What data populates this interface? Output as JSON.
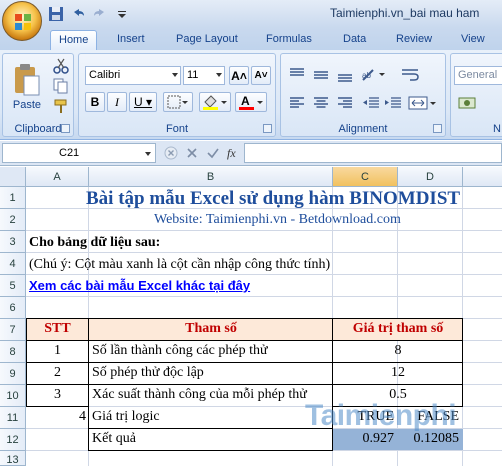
{
  "window": {
    "doc_title": "Taimienphi.vn_bai mau ham"
  },
  "ribbon_tabs": [
    "Home",
    "Insert",
    "Page Layout",
    "Formulas",
    "Data",
    "Review",
    "View"
  ],
  "ribbon": {
    "clipboard": {
      "paste_label": "Paste",
      "group_label": "Clipboard"
    },
    "font": {
      "font_name": "Calibri",
      "font_size": "11",
      "group_label": "Font"
    },
    "alignment": {
      "group_label": "Alignment"
    },
    "number": {
      "format": "General",
      "group_label": "N"
    }
  },
  "formula_bar": {
    "name_box": "C21",
    "fx_label": "fx",
    "formula": ""
  },
  "grid": {
    "columns": [
      "A",
      "B",
      "C",
      "D"
    ],
    "rows": [
      "1",
      "2",
      "3",
      "4",
      "5",
      "6",
      "7",
      "8",
      "9",
      "10",
      "11",
      "12",
      "13"
    ]
  },
  "sheet": {
    "title": "Bài tập mẫu Excel sử dụng hàm BINOMDIST",
    "website": "Website: Taimienphi.vn - Betdownload.com",
    "intro": "Cho bảng dữ liệu sau:",
    "note": "(Chú ý: Cột màu xanh là cột cần nhập công thức tính)",
    "link": "Xem các bài mẫu Excel khác tại đây",
    "header": {
      "stt": "STT",
      "param": "Tham số",
      "value": "Giá trị tham số"
    },
    "rows": [
      {
        "stt": "1",
        "param": "Số lần thành công các phép thử",
        "value": "8"
      },
      {
        "stt": "2",
        "param": "Số phép thử độc lập",
        "value": "12"
      },
      {
        "stt": "3",
        "param": "Xác suất thành công của mỗi phép thử",
        "value": "0.5"
      }
    ],
    "row11": {
      "stt": "4",
      "param": "Giá trị logic",
      "c": "TRUE",
      "d": "FALSE"
    },
    "row12": {
      "param": "Kết quả",
      "c": "0.927",
      "d": "0.12085"
    },
    "watermark": "Taimienphi"
  },
  "colors": {
    "header_fill": "#fde9d9",
    "header_text": "#c00000",
    "title_text": "#1f4e9c",
    "formula_fill": "#95b3d7",
    "link_text": "#0000ff"
  }
}
